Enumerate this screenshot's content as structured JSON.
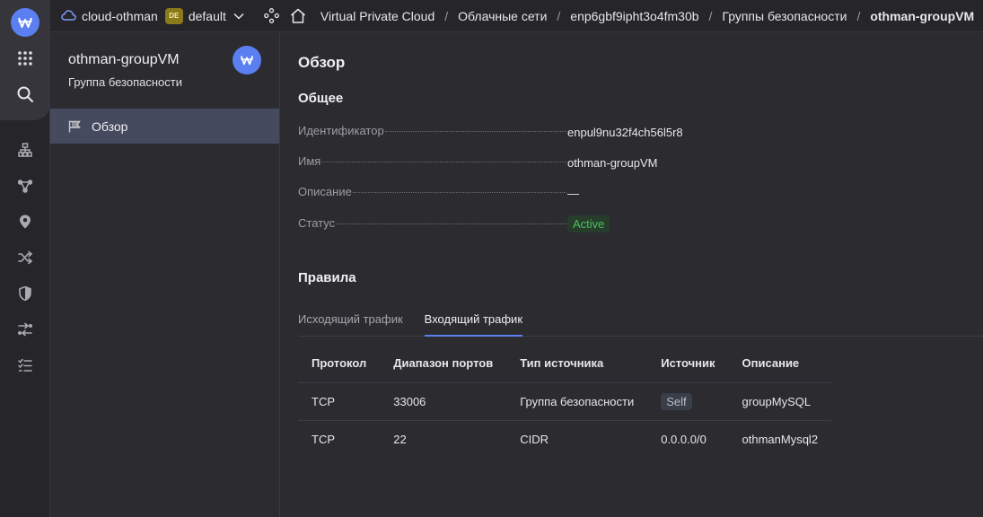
{
  "topbar": {
    "cloud_name": "cloud-othman",
    "folder_badge": "DE",
    "folder_name": "default",
    "breadcrumbs": [
      "Virtual Private Cloud",
      "Облачные сети",
      "enp6gbf9ipht3o4fm30b",
      "Группы безопасности",
      "othman-groupVM"
    ]
  },
  "sidebar": {
    "title": "othman-groupVM",
    "subtitle": "Группа безопасности",
    "nav": [
      {
        "label": "Обзор",
        "icon": "flag-icon"
      }
    ]
  },
  "main": {
    "title": "Обзор",
    "general_heading": "Общее",
    "properties": [
      {
        "key": "Идентификатор",
        "value": "enpul9nu32f4ch56l5r8"
      },
      {
        "key": "Имя",
        "value": "othman-groupVM"
      },
      {
        "key": "Описание",
        "value": "—"
      },
      {
        "key": "Статус",
        "value": "Active"
      }
    ],
    "rules_heading": "Правила",
    "tabs": [
      {
        "label": "Исходящий трафик",
        "active": false
      },
      {
        "label": "Входящий трафик",
        "active": true
      }
    ],
    "table": {
      "headers": [
        "Протокол",
        "Диапазон портов",
        "Тип источника",
        "Источник",
        "Описание"
      ],
      "rows": [
        [
          "TCP",
          "33006",
          "Группа безопасности",
          "Self",
          "groupMySQL"
        ],
        [
          "TCP",
          "22",
          "CIDR",
          "0.0.0.0/0",
          "othmanMysql2"
        ]
      ]
    }
  },
  "colors": {
    "accent": "#5b7ff0",
    "status_active_text": "#4bbf5e",
    "status_active_bg": "#263d2c",
    "badge_folder_bg": "#8a7a1a"
  }
}
